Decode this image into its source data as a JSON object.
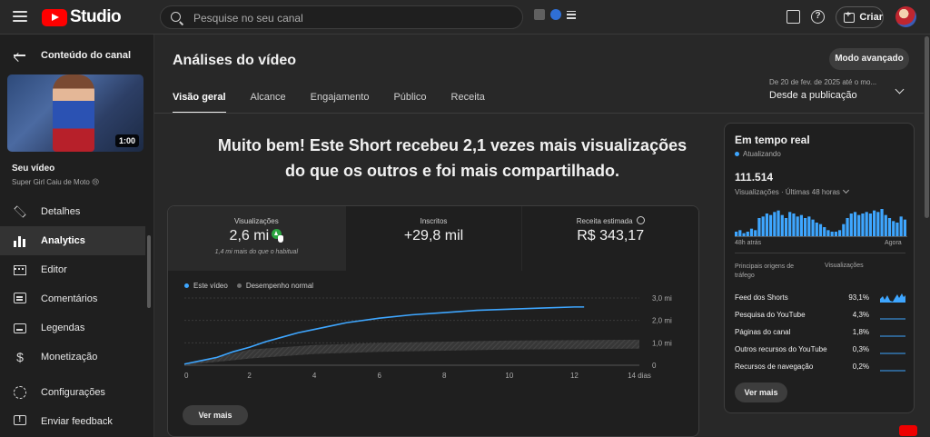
{
  "topbar": {
    "logo_text": "Studio",
    "search_placeholder": "Pesquise no seu canal",
    "create_label": "Criar"
  },
  "sidebar": {
    "back_label": "Conteúdo do canal",
    "thumbnail_duration": "1:00",
    "video_label": "Seu vídeo",
    "video_title": "Super Girl Caiu de Moto 😢",
    "items": [
      {
        "label": "Detalhes",
        "icon": "pencil-icon"
      },
      {
        "label": "Analytics",
        "icon": "analytics-icon",
        "active": true
      },
      {
        "label": "Editor",
        "icon": "film-icon"
      },
      {
        "label": "Comentários",
        "icon": "comments-icon"
      },
      {
        "label": "Legendas",
        "icon": "subtitles-icon"
      },
      {
        "label": "Monetização",
        "icon": "dollar-icon"
      }
    ],
    "bottom_items": [
      {
        "label": "Configurações",
        "icon": "gear-icon"
      },
      {
        "label": "Enviar feedback",
        "icon": "feedback-icon"
      }
    ]
  },
  "main": {
    "title": "Análises do vídeo",
    "advanced_button": "Modo avançado",
    "tabs": [
      {
        "label": "Visão geral",
        "active": true
      },
      {
        "label": "Alcance"
      },
      {
        "label": "Engajamento"
      },
      {
        "label": "Público"
      },
      {
        "label": "Receita"
      }
    ],
    "date_range_sub": "De 20 de fev. de 2025 até o mo...",
    "date_range_main": "Desde a publicação",
    "headline_1": "Muito bem! Este Short recebeu 2,1 vezes mais visualizações",
    "headline_2": "do que os outros e foi mais compartilhado.",
    "metrics": [
      {
        "label": "Visualizações",
        "value": "2,6 mi",
        "note": "1,4 mi mais do que o habitual"
      },
      {
        "label": "Inscritos",
        "value": "+29,8 mil"
      },
      {
        "label": "Receita estimada",
        "value": "R$ 343,17"
      }
    ],
    "legend_this": "Este vídeo",
    "legend_typical": "Desempenho normal",
    "more_button": "Ver mais"
  },
  "chart_data": {
    "type": "line",
    "x_ticks": [
      "0",
      "2",
      "4",
      "6",
      "8",
      "10",
      "12",
      "14 dias"
    ],
    "y_ticks": [
      "0",
      "1,0 mi",
      "2,0 mi",
      "3,0 mi"
    ],
    "ylim": [
      0,
      3.0
    ],
    "xlim": [
      0,
      14
    ],
    "series": [
      {
        "name": "Este vídeo",
        "color": "#3ea6ff",
        "x": [
          0,
          0.5,
          1,
          1.5,
          2,
          2.5,
          3,
          3.5,
          4,
          4.5,
          5,
          6,
          7,
          8,
          9,
          10,
          11,
          12,
          12.3
        ],
        "values": [
          0.05,
          0.2,
          0.35,
          0.6,
          0.8,
          1.05,
          1.25,
          1.45,
          1.6,
          1.75,
          1.9,
          2.1,
          2.25,
          2.35,
          2.45,
          2.5,
          2.55,
          2.6,
          2.6
        ]
      }
    ],
    "typical_band": {
      "name": "Desempenho normal",
      "x": [
        0,
        2,
        4,
        6,
        8,
        10,
        12,
        14
      ],
      "low": [
        0,
        0.3,
        0.5,
        0.6,
        0.65,
        0.7,
        0.72,
        0.74
      ],
      "high": [
        0,
        0.7,
        0.9,
        1.0,
        1.05,
        1.1,
        1.12,
        1.14
      ]
    }
  },
  "realtime": {
    "title": "Em tempo real",
    "status": "Atualizando",
    "count": "111.514",
    "period": "Visualizações · Últimas 48 horas",
    "axis_left": "48h atrás",
    "axis_right": "Agora",
    "bars": [
      3,
      4,
      2,
      3,
      5,
      4,
      12,
      13,
      15,
      14,
      16,
      17,
      14,
      12,
      16,
      15,
      13,
      14,
      12,
      13,
      11,
      9,
      8,
      6,
      4,
      3,
      3,
      4,
      8,
      12,
      15,
      16,
      14,
      15,
      16,
      15,
      17,
      16,
      18,
      14,
      12,
      10,
      9,
      13,
      11
    ],
    "header_source": "Principais origens de tráfego",
    "header_views": "Visualizações",
    "sources": [
      {
        "name": "Feed dos Shorts",
        "pct": "93,1%"
      },
      {
        "name": "Pesquisa do YouTube",
        "pct": "4,3%"
      },
      {
        "name": "Páginas do canal",
        "pct": "1,8%"
      },
      {
        "name": "Outros recursos do YouTube",
        "pct": "0,3%"
      },
      {
        "name": "Recursos de navegação",
        "pct": "0,2%"
      }
    ],
    "more_button": "Ver mais"
  },
  "colors": {
    "accent_blue": "#3ea6ff",
    "brand_red": "#ff0000",
    "success_green": "#2ba640"
  }
}
